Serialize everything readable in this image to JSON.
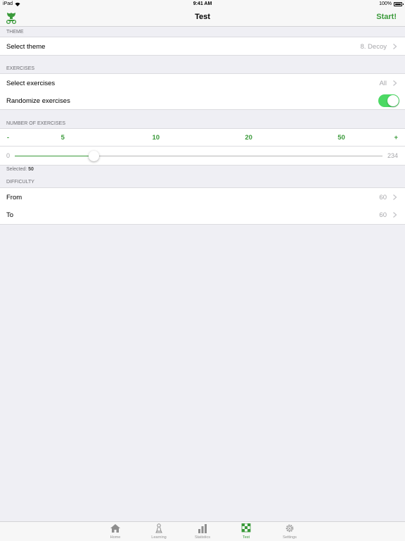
{
  "status_bar": {
    "device": "iPad",
    "time": "9:41 AM",
    "battery": "100%"
  },
  "nav": {
    "title": "Test",
    "start_label": "Start!"
  },
  "theme_section": {
    "header": "THEME",
    "select_theme": {
      "label": "Select theme",
      "value": "8. Decoy"
    }
  },
  "exercises_section": {
    "header": "EXERCISES",
    "select_exercises": {
      "label": "Select exercises",
      "value": "All"
    },
    "randomize": {
      "label": "Randomize exercises",
      "on": true
    }
  },
  "count_section": {
    "header": "NUMBER OF EXERCISES",
    "quick": [
      {
        "label": "-",
        "pos": 0.02
      },
      {
        "label": "5",
        "pos": 0.155
      },
      {
        "label": "10",
        "pos": 0.385
      },
      {
        "label": "20",
        "pos": 0.614
      },
      {
        "label": "50",
        "pos": 0.843
      },
      {
        "label": "+",
        "pos": 0.978
      }
    ],
    "slider": {
      "min": "0",
      "max": "234",
      "value": 50,
      "range_max": 234
    },
    "selected_label": "Selected:",
    "selected_value": "50"
  },
  "difficulty_section": {
    "header": "DIFFICULTY",
    "from": {
      "label": "From",
      "value": "60"
    },
    "to": {
      "label": "To",
      "value": "60"
    }
  },
  "tabs": [
    {
      "label": "Home",
      "icon": "house-icon",
      "active": false
    },
    {
      "label": "Learning",
      "icon": "pawn-icon",
      "active": false
    },
    {
      "label": "Statistics",
      "icon": "bar-chart-icon",
      "active": false
    },
    {
      "label": "Test",
      "icon": "checkerboard-icon",
      "active": true
    },
    {
      "label": "Settings",
      "icon": "gear-icon",
      "active": false
    }
  ],
  "colors": {
    "accent": "#3a9a3a",
    "toggle_on": "#4cd964",
    "background": "#efeff4",
    "muted": "#a6a6aa"
  }
}
